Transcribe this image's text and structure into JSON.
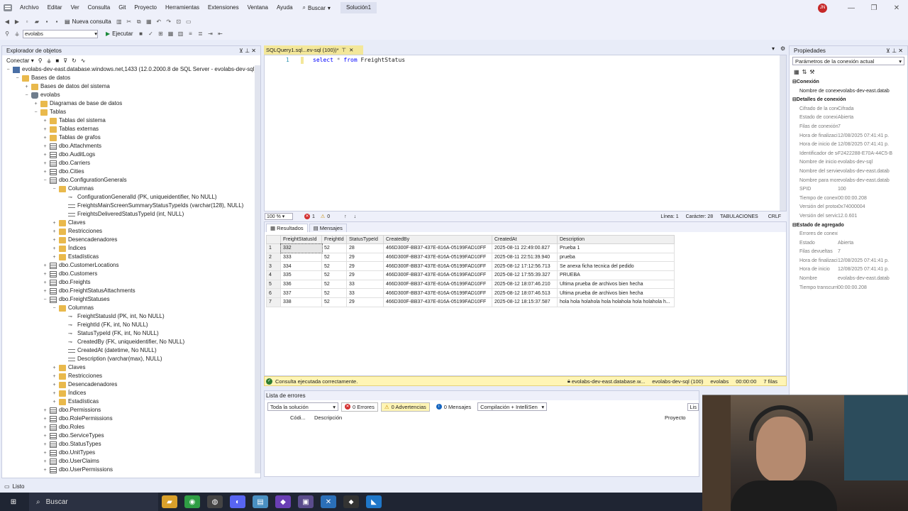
{
  "menu": {
    "items": [
      "Archivo",
      "Editar",
      "Ver",
      "Consulta",
      "Git",
      "Proyecto",
      "Herramientas",
      "Extensiones",
      "Ventana",
      "Ayuda"
    ],
    "search_label": "Buscar",
    "solution_label": "Solución1",
    "user_initials": "JN"
  },
  "toolbar": {
    "new_query_label": "Nueva consulta",
    "database_selected": "evolabs",
    "execute_label": "Ejecutar"
  },
  "object_explorer": {
    "title": "Explorador de objetos",
    "connect_label": "Conectar",
    "server": "evolabs-dev-east.database.windows.net,1433 (12.0.2000.8 de SQL Server - evolabs-dev-sql)",
    "nodes": [
      {
        "label": "Bases de datos",
        "indent": 1,
        "exp": "−",
        "icon": "folder"
      },
      {
        "label": "Bases de datos del sistema",
        "indent": 2,
        "exp": "+",
        "icon": "folder"
      },
      {
        "label": "evolabs",
        "indent": 2,
        "exp": "−",
        "icon": "db"
      },
      {
        "label": "Diagramas de base de datos",
        "indent": 3,
        "exp": "+",
        "icon": "folder"
      },
      {
        "label": "Tablas",
        "indent": 3,
        "exp": "−",
        "icon": "folder"
      },
      {
        "label": "Tablas del sistema",
        "indent": 4,
        "exp": "+",
        "icon": "folder"
      },
      {
        "label": "Tablas externas",
        "indent": 4,
        "exp": "+",
        "icon": "folder"
      },
      {
        "label": "Tablas de grafos",
        "indent": 4,
        "exp": "+",
        "icon": "folder"
      },
      {
        "label": "dbo.Attachments",
        "indent": 4,
        "exp": "+",
        "icon": "table"
      },
      {
        "label": "dbo.AuditLogs",
        "indent": 4,
        "exp": "+",
        "icon": "table"
      },
      {
        "label": "dbo.Carriers",
        "indent": 4,
        "exp": "+",
        "icon": "table"
      },
      {
        "label": "dbo.Cities",
        "indent": 4,
        "exp": "+",
        "icon": "table"
      },
      {
        "label": "dbo.ConfigurationGenerals",
        "indent": 4,
        "exp": "−",
        "icon": "table"
      },
      {
        "label": "Columnas",
        "indent": 5,
        "exp": "−",
        "icon": "folder"
      },
      {
        "label": "ConfigurationGeneralId (PK, uniqueidentifier, No NULL)",
        "indent": 6,
        "exp": "",
        "icon": "key"
      },
      {
        "label": "FreightsMainScreenSummaryStatusTypeIds (varchar(128), NULL)",
        "indent": 6,
        "exp": "",
        "icon": "col"
      },
      {
        "label": "FreightsDeliveredStatusTypeId (int, NULL)",
        "indent": 6,
        "exp": "",
        "icon": "col"
      },
      {
        "label": "Claves",
        "indent": 5,
        "exp": "+",
        "icon": "folder"
      },
      {
        "label": "Restricciones",
        "indent": 5,
        "exp": "+",
        "icon": "folder"
      },
      {
        "label": "Desencadenadores",
        "indent": 5,
        "exp": "+",
        "icon": "folder"
      },
      {
        "label": "Índices",
        "indent": 5,
        "exp": "+",
        "icon": "folder"
      },
      {
        "label": "Estadísticas",
        "indent": 5,
        "exp": "+",
        "icon": "folder"
      },
      {
        "label": "dbo.CustomerLocations",
        "indent": 4,
        "exp": "+",
        "icon": "table"
      },
      {
        "label": "dbo.Customers",
        "indent": 4,
        "exp": "+",
        "icon": "table"
      },
      {
        "label": "dbo.Freights",
        "indent": 4,
        "exp": "+",
        "icon": "table"
      },
      {
        "label": "dbo.FreightStatusAttachments",
        "indent": 4,
        "exp": "+",
        "icon": "table"
      },
      {
        "label": "dbo.FreightStatuses",
        "indent": 4,
        "exp": "−",
        "icon": "table"
      },
      {
        "label": "Columnas",
        "indent": 5,
        "exp": "−",
        "icon": "folder"
      },
      {
        "label": "FreightStatusId (PK, int, No NULL)",
        "indent": 6,
        "exp": "",
        "icon": "key"
      },
      {
        "label": "FreightId (FK, int, No NULL)",
        "indent": 6,
        "exp": "",
        "icon": "key"
      },
      {
        "label": "StatusTypeId (FK, int, No NULL)",
        "indent": 6,
        "exp": "",
        "icon": "key"
      },
      {
        "label": "CreatedBy (FK, uniqueidentifier, No NULL)",
        "indent": 6,
        "exp": "",
        "icon": "key"
      },
      {
        "label": "CreatedAt (datetime, No NULL)",
        "indent": 6,
        "exp": "",
        "icon": "col"
      },
      {
        "label": "Description (varchar(max), NULL)",
        "indent": 6,
        "exp": "",
        "icon": "col"
      },
      {
        "label": "Claves",
        "indent": 5,
        "exp": "+",
        "icon": "folder"
      },
      {
        "label": "Restricciones",
        "indent": 5,
        "exp": "+",
        "icon": "folder"
      },
      {
        "label": "Desencadenadores",
        "indent": 5,
        "exp": "+",
        "icon": "folder"
      },
      {
        "label": "Índices",
        "indent": 5,
        "exp": "+",
        "icon": "folder"
      },
      {
        "label": "Estadísticas",
        "indent": 5,
        "exp": "+",
        "icon": "folder"
      },
      {
        "label": "dbo.Permissions",
        "indent": 4,
        "exp": "+",
        "icon": "table"
      },
      {
        "label": "dbo.RolePermissions",
        "indent": 4,
        "exp": "+",
        "icon": "table"
      },
      {
        "label": "dbo.Roles",
        "indent": 4,
        "exp": "+",
        "icon": "table"
      },
      {
        "label": "dbo.ServiceTypes",
        "indent": 4,
        "exp": "+",
        "icon": "table"
      },
      {
        "label": "dbo.StatusTypes",
        "indent": 4,
        "exp": "+",
        "icon": "table"
      },
      {
        "label": "dbo.UnitTypes",
        "indent": 4,
        "exp": "+",
        "icon": "table"
      },
      {
        "label": "dbo.UserClaims",
        "indent": 4,
        "exp": "+",
        "icon": "table"
      },
      {
        "label": "dbo.UserPermissions",
        "indent": 4,
        "exp": "+",
        "icon": "table"
      }
    ]
  },
  "editor": {
    "tab_label": "SQLQuery1.sql...ev-sql (100))*",
    "line_number": "1",
    "code": {
      "kw1": "select",
      "op": "*",
      "kw2": "from",
      "ident": "FreightStatus"
    },
    "zoom": "100 %",
    "errors_count": "1",
    "warnings_count": "0",
    "line_info": "Línea: 1",
    "char_info": "Carácter: 28",
    "tabs_info": "TABULACIONES",
    "eol_info": "CRLF"
  },
  "results": {
    "tab_results": "Resultados",
    "tab_messages": "Mensajes",
    "columns": [
      "FreightStatusId",
      "FreightId",
      "StatusTypeId",
      "CreatedBy",
      "CreatedAt",
      "Description"
    ],
    "rows": [
      [
        "1",
        "332",
        "52",
        "28",
        "466D300F-BB37-437E-816A-05199FAD10FF",
        "2025-08-11 22:49:00.827",
        "Prueba 1"
      ],
      [
        "2",
        "333",
        "52",
        "29",
        "466D300F-BB37-437E-816A-05199FAD10FF",
        "2025-08-11 22:51:39.940",
        "prueba"
      ],
      [
        "3",
        "334",
        "52",
        "29",
        "466D300F-BB37-437E-816A-05199FAD10FF",
        "2025-08-12 17:12:56.713",
        "Se anexa ficha tecnica del pedido"
      ],
      [
        "4",
        "335",
        "52",
        "29",
        "466D300F-BB37-437E-816A-05199FAD10FF",
        "2025-08-12 17:55:39.327",
        "PRUEBA"
      ],
      [
        "5",
        "336",
        "52",
        "33",
        "466D300F-BB37-437E-816A-05199FAD10FF",
        "2025-08-12 18:07:46.210",
        "Ultima prueba de archivos bien hecha"
      ],
      [
        "6",
        "337",
        "52",
        "33",
        "466D300F-BB37-437E-816A-05199FAD10FF",
        "2025-08-12 18:07:46.513",
        "Ultima prueba de archivos bien hecha"
      ],
      [
        "7",
        "338",
        "52",
        "29",
        "466D300F-BB37-437E-816A-05199FAD10FF",
        "2025-08-12 18:15:37.587",
        "hola hola holahola hola holahola hola holahola h..."
      ]
    ]
  },
  "query_status": {
    "message": "Consulta ejecutada correctamente.",
    "server": "evolabs-dev-east.database.w...",
    "login": "evolabs-dev-sql (100)",
    "database": "evolabs",
    "elapsed": "00:00:00",
    "rows": "7 filas"
  },
  "error_list": {
    "title": "Lista de errores",
    "scope": "Toda la solución",
    "errors": "0 Errores",
    "warnings": "0 Advertencias",
    "messages": "0 Mensajes",
    "build": "Compilación + IntelliSen",
    "col_code": "Códi...",
    "col_description": "Descripción",
    "col_project": "Proyecto",
    "search_stub": "Lis"
  },
  "properties": {
    "title": "Propiedades",
    "selector": "Parámetros de la conexión actual",
    "rows": [
      {
        "cat": true,
        "k": "Conexión",
        "v": ""
      },
      {
        "cat": false,
        "k": "Nombre de conexi",
        "v": "evolabs-dev-east.datab",
        "dark": true
      },
      {
        "cat": true,
        "k": "Detalles de conexión",
        "v": ""
      },
      {
        "cat": false,
        "k": "Cifrado de la cone",
        "v": "Cifrada"
      },
      {
        "cat": false,
        "k": "Estado de conexió",
        "v": "Abierta"
      },
      {
        "cat": false,
        "k": "Filas de conexión (",
        "v": "7"
      },
      {
        "cat": false,
        "k": "Hora de finalizació",
        "v": "12/08/2025 07:41:41 p."
      },
      {
        "cat": false,
        "k": "Hora de inicio de l",
        "v": "12/08/2025 07:41:41 p."
      },
      {
        "cat": false,
        "k": "Identificador de se",
        "v": "F2422288-E70A-44C5-B"
      },
      {
        "cat": false,
        "k": "Nombre de inicio d",
        "v": "evolabs-dev-sql"
      },
      {
        "cat": false,
        "k": "Nombre del servid",
        "v": "evolabs-dev-east.datab"
      },
      {
        "cat": false,
        "k": "Nombre para mos",
        "v": "evolabs-dev-east.datab"
      },
      {
        "cat": false,
        "k": "SPID",
        "v": "100"
      },
      {
        "cat": false,
        "k": "Tiempo de conexió",
        "v": "00:00:00.208"
      },
      {
        "cat": false,
        "k": "Versión del protoc",
        "v": "0x74000004"
      },
      {
        "cat": false,
        "k": "Versión del servido",
        "v": "12.0.601"
      },
      {
        "cat": true,
        "k": "Estado de agregado",
        "v": ""
      },
      {
        "cat": false,
        "k": "Errores de conexió",
        "v": ""
      },
      {
        "cat": false,
        "k": "Estado",
        "v": "Abierta"
      },
      {
        "cat": false,
        "k": "Filas devueltas",
        "v": "7"
      },
      {
        "cat": false,
        "k": "Hora de finalizació",
        "v": "12/08/2025 07:41:41 p."
      },
      {
        "cat": false,
        "k": "Hora de inicio",
        "v": "12/08/2025 07:41:41 p."
      },
      {
        "cat": false,
        "k": "Nombre",
        "v": "evolabs-dev-east.datab"
      },
      {
        "cat": false,
        "k": "Tiempo transcurri",
        "v": "00:00:00.208"
      }
    ]
  },
  "statusbar": {
    "text": "Listo"
  },
  "taskbar": {
    "search_label": "Buscar"
  },
  "colors": {
    "tab_active": "#f3e79a",
    "success_bar": "#fff5b5",
    "keyword": "#0000ff"
  }
}
